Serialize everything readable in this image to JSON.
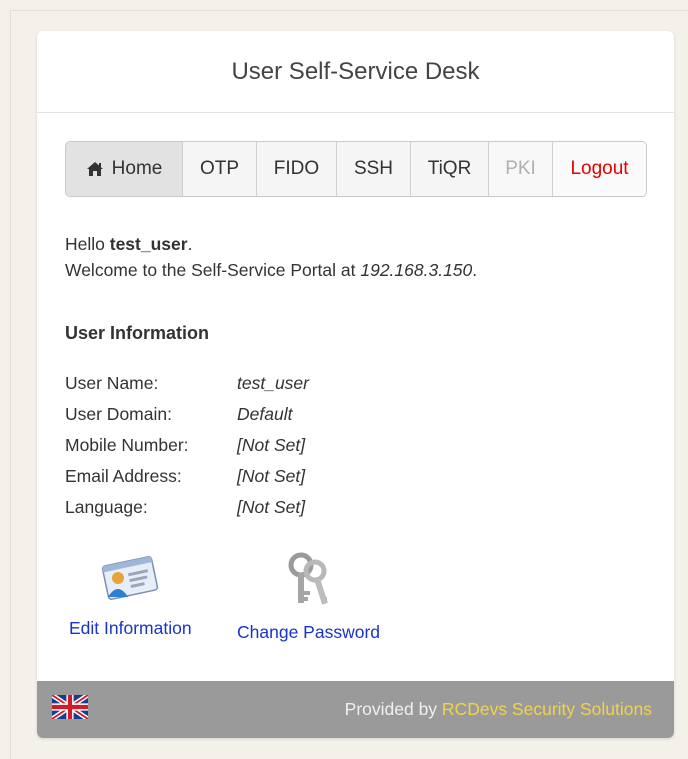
{
  "header": {
    "title": "User Self-Service Desk"
  },
  "nav": {
    "items": [
      {
        "label": "Home",
        "icon": "home-icon",
        "state": "active"
      },
      {
        "label": "OTP",
        "state": "normal"
      },
      {
        "label": "FIDO",
        "state": "normal"
      },
      {
        "label": "SSH",
        "state": "normal"
      },
      {
        "label": "TiQR",
        "state": "normal"
      },
      {
        "label": "PKI",
        "state": "disabled"
      },
      {
        "label": "Logout",
        "state": "logout"
      }
    ]
  },
  "greeting": {
    "hello_prefix": "Hello ",
    "username": "test_user",
    "hello_suffix": ".",
    "welcome_prefix": "Welcome to the Self-Service Portal at ",
    "ip": "192.168.3.150",
    "welcome_suffix": "."
  },
  "user_info": {
    "title": "User Information",
    "rows": [
      {
        "label": "User Name:",
        "value": "test_user"
      },
      {
        "label": "User Domain:",
        "value": "Default"
      },
      {
        "label": "Mobile Number:",
        "value": "[Not Set]"
      },
      {
        "label": "Email Address:",
        "value": "[Not Set]"
      },
      {
        "label": "Language:",
        "value": "[Not Set]"
      }
    ]
  },
  "actions": {
    "edit_info": {
      "label": "Edit Information",
      "icon": "id-card-icon"
    },
    "change_password": {
      "label": "Change Password",
      "icon": "keys-icon"
    }
  },
  "footer": {
    "flag_icon": "uk-flag-icon",
    "provided_by": "Provided by ",
    "company": "RCDevs Security Solutions"
  },
  "colors": {
    "logout": "#e60000",
    "link": "#1a33cc",
    "footer_bg": "#9a9a9a",
    "footer_link": "#f3d24a"
  }
}
